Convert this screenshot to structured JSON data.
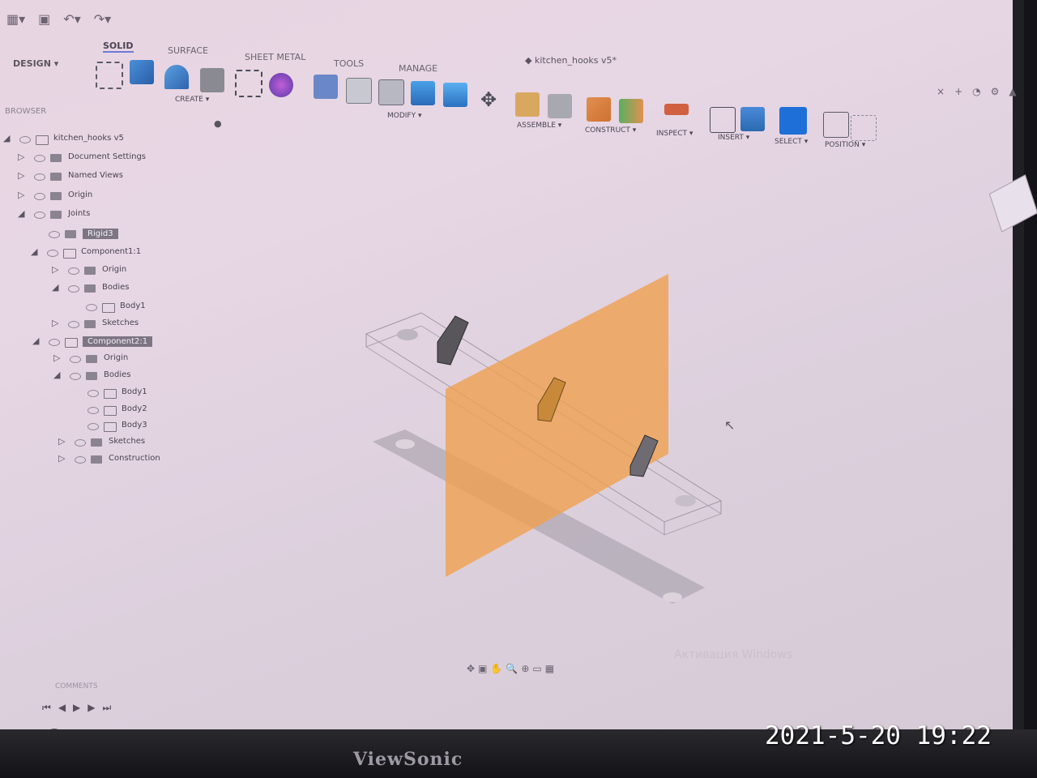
{
  "app": {
    "workspace_label": "DESIGN ▾",
    "document_title": "kitchen_hooks v5*"
  },
  "toolbar": {
    "tabs": [
      "SOLID",
      "SURFACE",
      "SHEET METAL",
      "TOOLS",
      "MANAGE"
    ],
    "groups": {
      "create": "CREATE ▾",
      "modify": "MODIFY ▾",
      "assemble": "ASSEMBLE ▾",
      "construct": "CONSTRUCT ▾",
      "inspect": "INSPECT ▾",
      "insert": "INSERT ▾",
      "select": "SELECT ▾",
      "position": "POSITION ▾"
    }
  },
  "browser": {
    "header": "BROWSER",
    "items": [
      {
        "label": "kitchen_hooks v5",
        "level": 0
      },
      {
        "label": "Document Settings",
        "level": 1
      },
      {
        "label": "Named Views",
        "level": 1
      },
      {
        "label": "Origin",
        "level": 1
      },
      {
        "label": "Joints",
        "level": 1
      },
      {
        "label": "Rigid3",
        "level": 2,
        "selected": true
      },
      {
        "label": "Component1:1",
        "level": 1
      },
      {
        "label": "Origin",
        "level": 2
      },
      {
        "label": "Bodies",
        "level": 2
      },
      {
        "label": "Body1",
        "level": 3
      },
      {
        "label": "Sketches",
        "level": 2
      },
      {
        "label": "Component2:1",
        "level": 1,
        "selected": true
      },
      {
        "label": "Origin",
        "level": 2
      },
      {
        "label": "Bodies",
        "level": 2
      },
      {
        "label": "Body1",
        "level": 3
      },
      {
        "label": "Body2",
        "level": 3
      },
      {
        "label": "Body3",
        "level": 3
      },
      {
        "label": "Sketches",
        "level": 2
      },
      {
        "label": "Construction",
        "level": 2
      }
    ]
  },
  "bottom": {
    "comments_label": "COMMENTS",
    "activate_windows": "Активация Windows"
  },
  "photo": {
    "monitor_brand": "ViewSonic",
    "timestamp": "2021-5-20 19:22"
  },
  "colors": {
    "construction_plane": "#f0a050",
    "selected_body": "#c88a3a",
    "body_dark": "#58565a"
  }
}
